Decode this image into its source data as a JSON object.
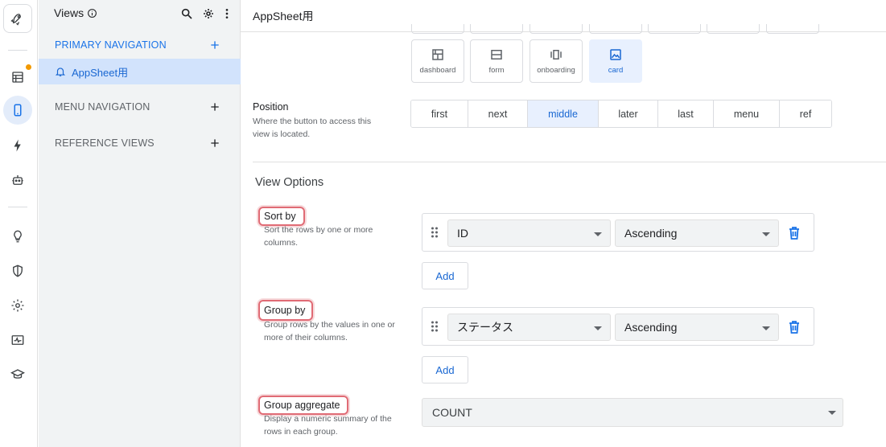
{
  "rail": {
    "icons": [
      "rocket-icon",
      "data-table-icon",
      "phone-icon",
      "bolt-icon",
      "bot-icon",
      "lightbulb-icon",
      "shield-icon",
      "gear-icon",
      "monitor-pulse-icon",
      "graduation-cap-icon"
    ],
    "accent": "#1a73e8",
    "notify_color": "#f29900"
  },
  "views_panel": {
    "title": "Views",
    "sections": {
      "primary": "PRIMARY NAVIGATION",
      "menu": "MENU NAVIGATION",
      "reference": "REFERENCE VIEWS"
    },
    "primary_items": [
      {
        "label": "AppSheet用",
        "selected": true
      }
    ]
  },
  "main": {
    "app_title": "AppSheet用",
    "view_types": [
      {
        "label": "dashboard",
        "icon": "dashboard-icon",
        "selected": false
      },
      {
        "label": "form",
        "icon": "form-icon",
        "selected": false
      },
      {
        "label": "onboarding",
        "icon": "onboarding-icon",
        "selected": false
      },
      {
        "label": "card",
        "icon": "image-icon",
        "selected": true
      }
    ],
    "position": {
      "label": "Position",
      "description": "Where the button to access this view is located.",
      "options": [
        "first",
        "next",
        "middle",
        "later",
        "last",
        "menu",
        "ref"
      ],
      "selected": "middle"
    },
    "view_options": {
      "title": "View Options",
      "sort_by": {
        "label": "Sort by",
        "description": "Sort the rows by one or more columns.",
        "column": "ID",
        "order": "Ascending",
        "add_label": "Add"
      },
      "group_by": {
        "label": "Group by",
        "description": "Group rows by the values in one or more of their columns.",
        "column": "ステータス",
        "order": "Ascending",
        "add_label": "Add"
      },
      "group_aggregate": {
        "label": "Group aggregate",
        "description": "Display a numeric summary of the rows in each group.",
        "value": "COUNT"
      }
    },
    "highlight_color": "#e06b75"
  }
}
